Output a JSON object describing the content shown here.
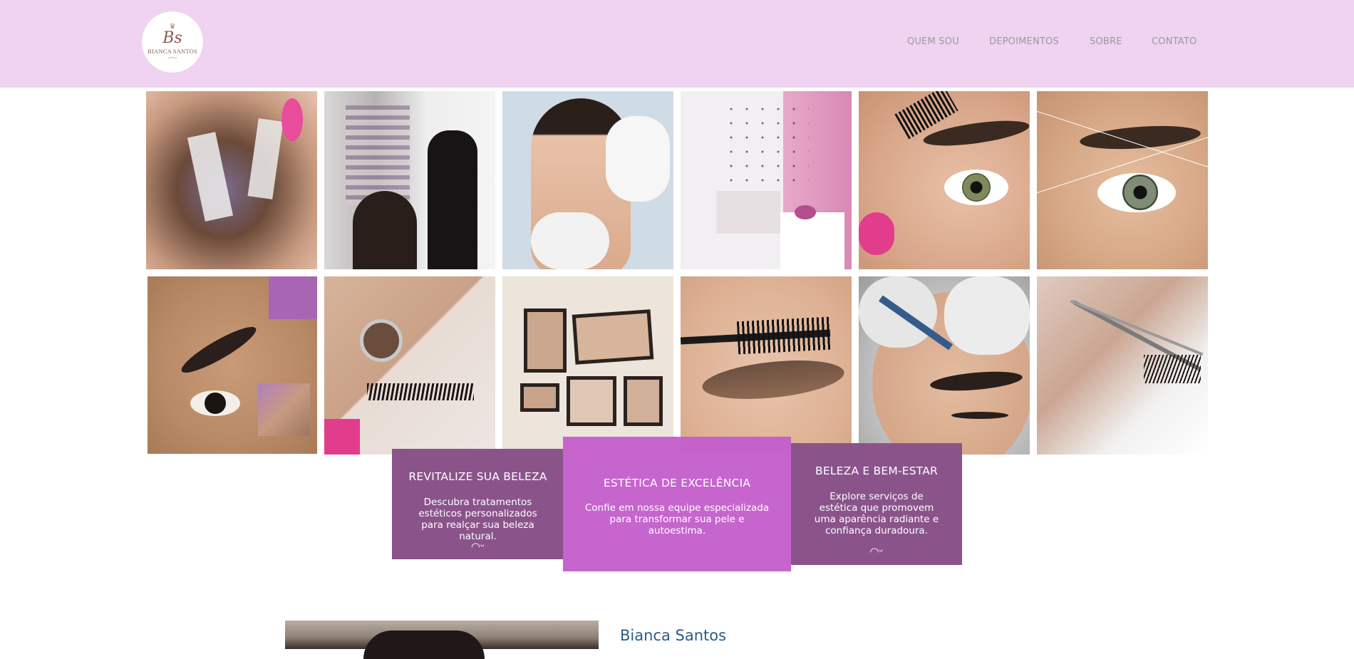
{
  "header": {
    "logo": {
      "monogram": "Bs",
      "brand": "BIANCA SANTOS"
    },
    "nav": [
      "QUEM SOU",
      "DEPOIMENTOS",
      "SOBRE",
      "CONTATO"
    ]
  },
  "gallery": [
    {
      "subject": "lash-extension-application"
    },
    {
      "subject": "esthetician-working-in-salon"
    },
    {
      "subject": "woman-face-gloved-hands"
    },
    {
      "subject": "treatment-room"
    },
    {
      "subject": "brow-spoolie-and-tweezers"
    },
    {
      "subject": "brow-threading"
    },
    {
      "subject": "brow-and-lash-result"
    },
    {
      "subject": "lash-mirror-inspection"
    },
    {
      "subject": "framed-spa-pictures-wall"
    },
    {
      "subject": "brow-spoolie-closeup"
    },
    {
      "subject": "brow-micropigmentation"
    },
    {
      "subject": "lash-tweezers-closeup"
    }
  ],
  "cards": [
    {
      "title": "REVITALIZE SUA BELEZA",
      "text": "Descubra tratamentos estéticos personalizados para realçar sua beleza natural.",
      "icon": "eyelash-icon"
    },
    {
      "title": "ESTÉTICA DE EXCELÊNCIA",
      "text": "Confie em nossa equipe especializada para transformar sua pele e autoestima."
    },
    {
      "title": "BELEZA E BEM-ESTAR",
      "text": "Explore serviços de estética que promovem uma aparência radiante e confiança duradoura.",
      "icon": "eyelash-icon"
    }
  ],
  "about": {
    "name": "Bianca Santos"
  },
  "colors": {
    "header_bg": "#efd3f1",
    "card_dark": "#8a548a",
    "card_bright": "#c45fcb",
    "name": "#2a5b88",
    "nav": "#9a9a9a"
  }
}
